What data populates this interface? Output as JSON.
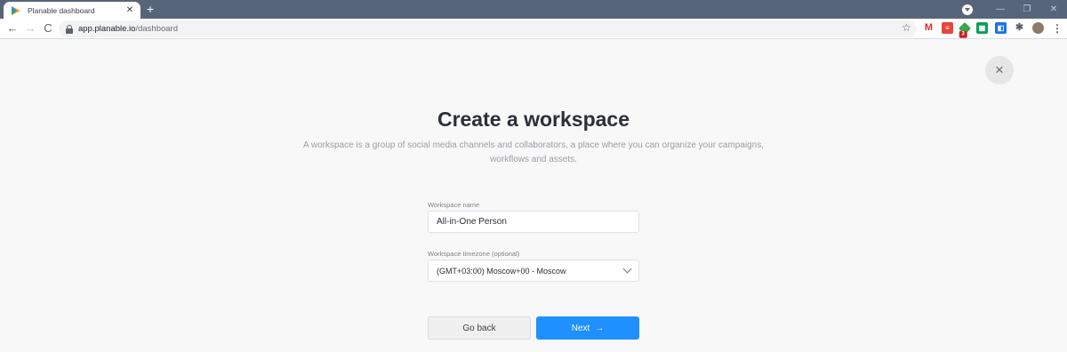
{
  "browser": {
    "tab_title": "Planable dashboard",
    "tab_close": "✕",
    "new_tab": "+",
    "url_host": "app.planable.io",
    "url_path": "/dashboard",
    "nav_back": "←",
    "nav_forward": "→",
    "nav_reload": "C",
    "star": "☆",
    "menu": "⋮",
    "win_minimize": "—",
    "win_restore": "❐",
    "win_close": "✕",
    "extension_badge": "3",
    "colors": {
      "titlebar": "#57657a",
      "gmail": "#d93025",
      "red_ext": "#e8453c",
      "green_ext": "#34a853",
      "blue_ext": "#1a73e8"
    }
  },
  "page": {
    "close_label": "×",
    "title": "Create a workspace",
    "subtitle": "A workspace is a group of social media channels and collaborators, a place where you can organize your campaigns, workflows and assets.",
    "workspace_name_label": "Workspace name",
    "workspace_name_value": "All-in-One Person",
    "timezone_label": "Workspace timezone (optional)",
    "timezone_value": "(GMT+03:00) Moscow+00 - Moscow",
    "back_button": "Go back",
    "next_button": "Next",
    "next_arrow": "→",
    "accent_color": "#1e90ff"
  }
}
